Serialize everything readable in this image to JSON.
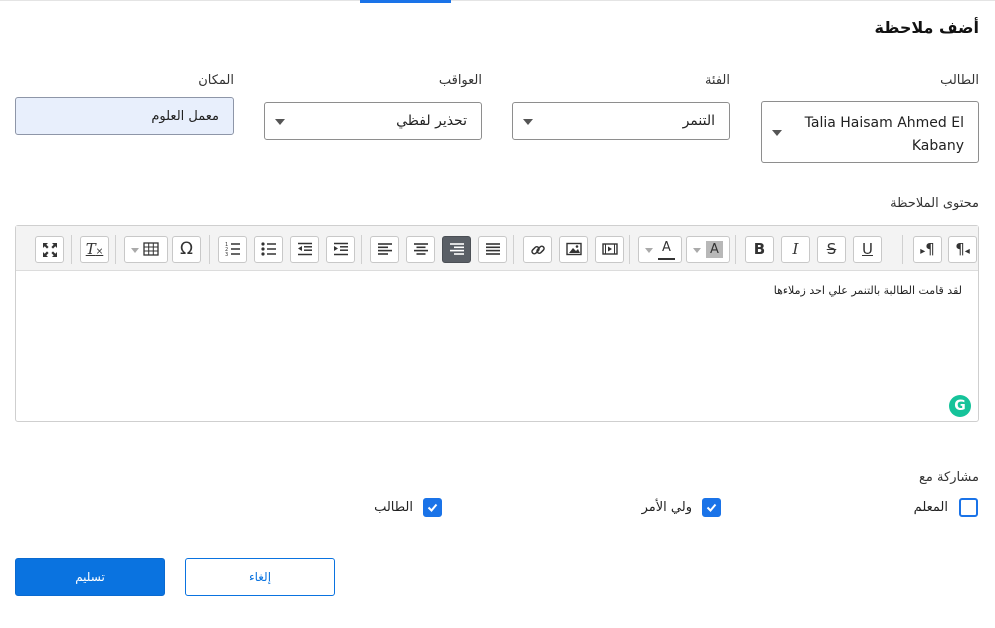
{
  "form": {
    "title": "أضف ملاحظة",
    "student": {
      "label": "الطالب",
      "value": "Talia Haisam Ahmed El Kabany"
    },
    "category": {
      "label": "الفئة",
      "value": "التنمر"
    },
    "consequences": {
      "label": "العواقب",
      "value": "تحذير لفظي"
    },
    "place": {
      "label": "المكان",
      "value": "معمل العلوم"
    },
    "content_label": "محتوى الملاحظة",
    "content_text": "لقد قامت الطالبة بالتنمر علي احد زملاءها"
  },
  "toolbar": {
    "icons": [
      "paragraph-rtl-icon",
      "paragraph-ltr-icon",
      "underline-icon",
      "strikethrough-icon",
      "italic-icon",
      "bold-icon",
      "background-color-icon",
      "text-color-icon",
      "media-icon",
      "image-icon",
      "link-icon",
      "align-justify-icon",
      "align-right-icon",
      "align-center-icon",
      "align-left-icon",
      "indent-icon",
      "outdent-icon",
      "bulleted-list-icon",
      "numbered-list-icon",
      "special-character-icon",
      "table-icon",
      "clear-formatting-icon",
      "fullscreen-icon"
    ],
    "bold": "B",
    "italic": "I",
    "strike": "S",
    "underline": "U",
    "omega": "Ω",
    "text_color_letter": "A",
    "bg_color_letter": "A",
    "clear_format": "T",
    "active_align": "right"
  },
  "share": {
    "label": "مشاركة مع",
    "options": [
      {
        "label": "المعلم",
        "checked": false
      },
      {
        "label": "ولي الأمر",
        "checked": true
      },
      {
        "label": "الطالب",
        "checked": true
      }
    ]
  },
  "actions": {
    "submit": "تسليم",
    "cancel": "إلغاء"
  },
  "colors": {
    "accent": "#0a73e0",
    "checkbox": "#1a73e8",
    "grammarly": "#15c39a",
    "place_bg": "#e8effc"
  },
  "grammarly_badge": "G"
}
